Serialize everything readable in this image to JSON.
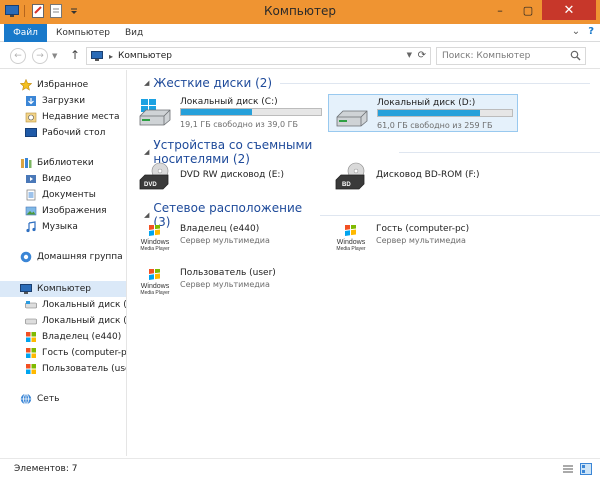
{
  "window": {
    "title": "Компьютер",
    "minimize_glyph": "–",
    "maximize_glyph": "▢",
    "close_glyph": "✕"
  },
  "ribbon": {
    "tabs": [
      "Файл",
      "Компьютер",
      "Вид"
    ],
    "expand_glyph": "⌄",
    "help_glyph": "?"
  },
  "address": {
    "back_glyph": "←",
    "forward_glyph": "→",
    "up_glyph": "↑",
    "crumb_separator": "▸",
    "crumb": "Компьютер",
    "search_placeholder": "Поиск: Компьютер"
  },
  "sidebar": {
    "favorites": {
      "label": "Избранное",
      "items": [
        "Загрузки",
        "Недавние места",
        "Рабочий стол"
      ]
    },
    "libraries": {
      "label": "Библиотеки",
      "items": [
        "Видео",
        "Документы",
        "Изображения",
        "Музыка"
      ]
    },
    "homegroup": {
      "label": "Домашняя группа"
    },
    "computer": {
      "label": "Компьютер",
      "items": [
        "Локальный диск (C:)",
        "Локальный диск (D:)",
        "Владелец (e440)",
        "Гость (computer-pc)",
        "Пользователь (user)"
      ]
    },
    "network": {
      "label": "Сеть"
    }
  },
  "groups": {
    "hdd": {
      "title": "Жесткие диски (2)"
    },
    "removable": {
      "title": "Устройства со съемными носителями (2)"
    },
    "network": {
      "title": "Сетевое расположение (3)"
    }
  },
  "drives": [
    {
      "name": "Локальный диск (C:)",
      "free": "19,1 ГБ свободно из 39,0 ГБ",
      "used_fraction": 0.51,
      "selected": false
    },
    {
      "name": "Локальный диск (D:)",
      "free": "61,0 ГБ свободно из 259 ГБ",
      "used_fraction": 0.76,
      "selected": true
    }
  ],
  "removable": [
    {
      "name": "DVD RW дисковод (E:)",
      "badge": "DVD"
    },
    {
      "name": "Дисковод BD-ROM (F:)",
      "badge": "BD"
    }
  ],
  "network_items": [
    {
      "name": "Владелец (e440)",
      "sub": "Сервер мультимедиа"
    },
    {
      "name": "Гость (computer-pc)",
      "sub": "Сервер мультимедиа"
    },
    {
      "name": "Пользователь (user)",
      "sub": "Сервер мультимедиа"
    }
  ],
  "wmp_label": [
    "Windows",
    "Media Player"
  ],
  "status": {
    "count": "Элементов: 7"
  },
  "colors": {
    "accent": "#1979ca",
    "title_bar": "#ef9432",
    "bar_fill": "#26a0da",
    "group_heading": "#1e4a9a"
  }
}
